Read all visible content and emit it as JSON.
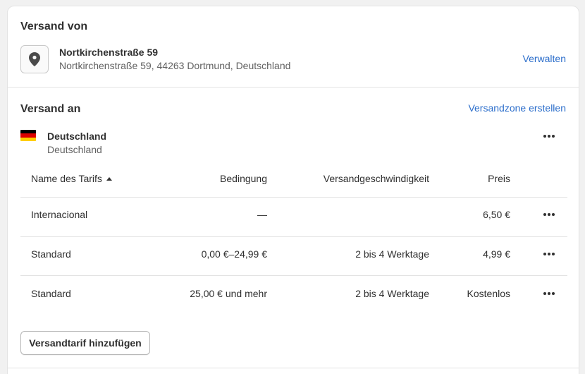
{
  "origin": {
    "title": "Versand von",
    "location_name": "Nortkirchenstraße 59",
    "location_address": "Nortkirchenstraße 59, 44263 Dortmund, Deutschland",
    "manage_link": "Verwalten",
    "icon": "location-pin-icon"
  },
  "destination": {
    "title": "Versand an",
    "create_zone_link": "Versandzone erstellen",
    "zone": {
      "name": "Deutschland",
      "countries": "Deutschland",
      "flag_colors": [
        "#000000",
        "#dd0000",
        "#ffce00"
      ]
    }
  },
  "rates_table": {
    "headers": {
      "name": "Name des Tarifs",
      "condition": "Bedingung",
      "speed": "Versandgeschwindigkeit",
      "price": "Preis"
    },
    "sort": "ascending",
    "rows": [
      {
        "name": "Internacional",
        "condition": "—",
        "speed": "",
        "price": "6,50 €"
      },
      {
        "name": "Standard",
        "condition": "0,00 €–24,99 €",
        "speed": "2 bis 4 Werktage",
        "price": "4,99 €"
      },
      {
        "name": "Standard",
        "condition": "25,00 € und mehr",
        "speed": "2 bis 4 Werktage",
        "price": "Kostenlos"
      }
    ]
  },
  "add_rate_button": "Versandtarif hinzufügen",
  "colors": {
    "link": "#2c6ecb",
    "text": "#303030",
    "subdued": "#616161",
    "border": "#e3e3e3"
  }
}
